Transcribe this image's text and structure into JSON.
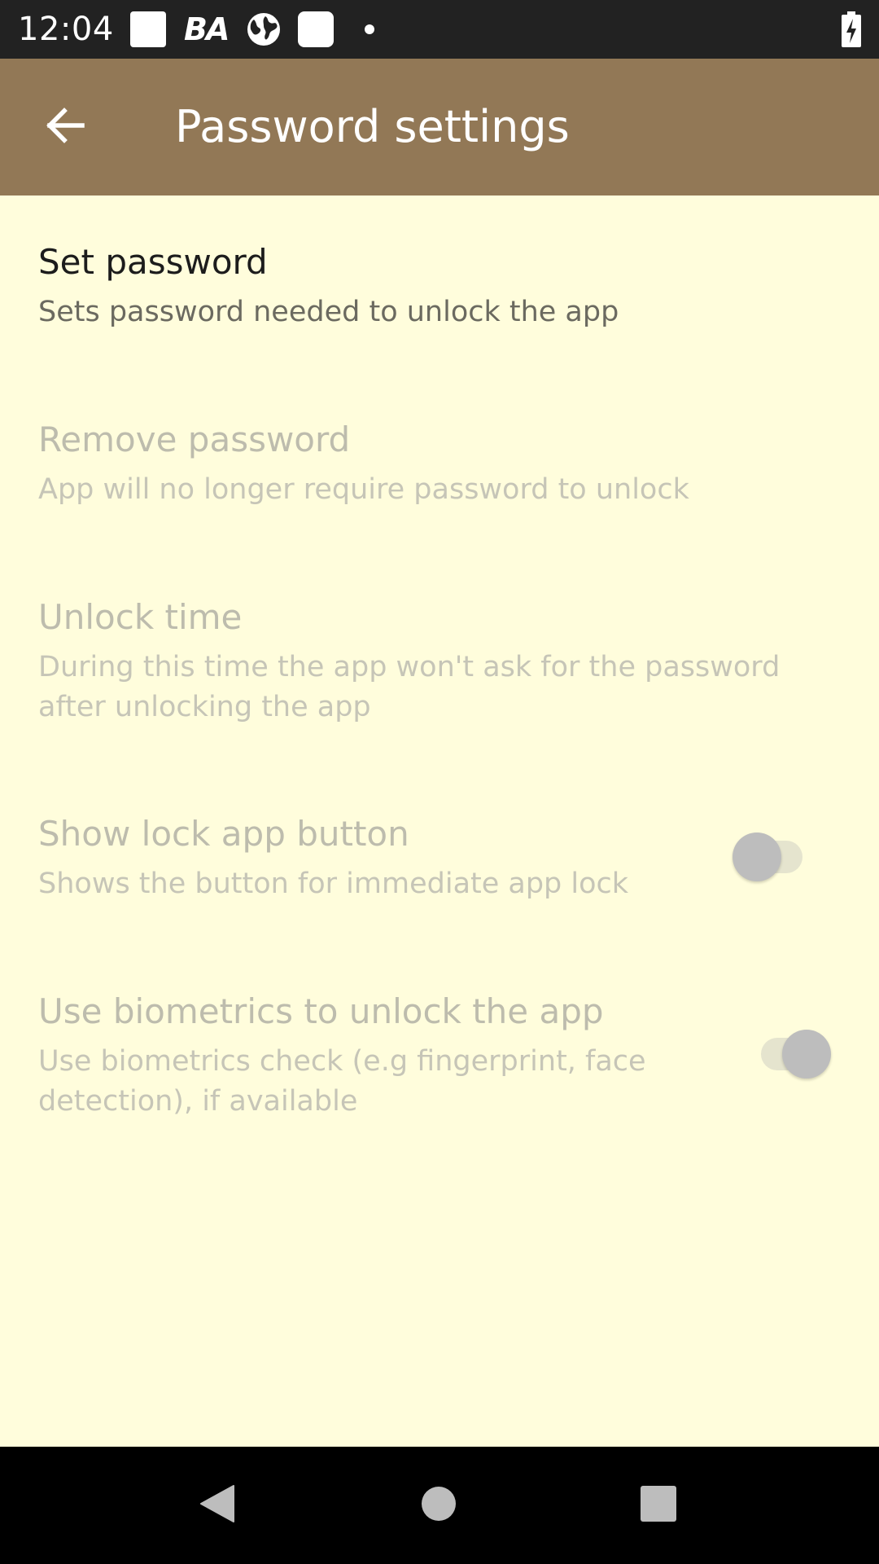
{
  "status_bar": {
    "time": "12:04",
    "notification_icons": [
      "square-notification-icon",
      "ba-icon",
      "globe-icon",
      "square-notification-icon",
      "dot-icon"
    ],
    "ba_label": "BA",
    "battery_icon": "battery-charging-icon"
  },
  "app_bar": {
    "back_icon": "arrow-back-icon",
    "title": "Password settings",
    "background_color": "#927856"
  },
  "settings": [
    {
      "id": "set-password",
      "title": "Set password",
      "summary": "Sets password needed to unlock the app",
      "enabled": true
    },
    {
      "id": "remove-password",
      "title": "Remove password",
      "summary": "App will no longer require password to unlock",
      "enabled": false
    },
    {
      "id": "unlock-time",
      "title": "Unlock time",
      "summary_line1": "During this time the app won't ask for the password",
      "summary_line2": "after unlocking the app",
      "enabled": false
    },
    {
      "id": "show-lock-app-button",
      "title": "Show lock app button",
      "summary": "Shows the button for immediate app lock",
      "enabled": false,
      "switch_on": false
    },
    {
      "id": "use-biometrics",
      "title": "Use biometrics to unlock the app",
      "summary_line1": "Use biometrics check (e.g fingerprint, face",
      "summary_line2": "detection), if available",
      "enabled": false,
      "switch_on": true
    }
  ],
  "nav_bar": {
    "back": "nav-back-icon",
    "home": "nav-home-icon",
    "recents": "nav-recents-icon"
  },
  "colors": {
    "page_background": "#FFFDDC",
    "status_bar": "#222222",
    "nav_bar": "#000000"
  }
}
